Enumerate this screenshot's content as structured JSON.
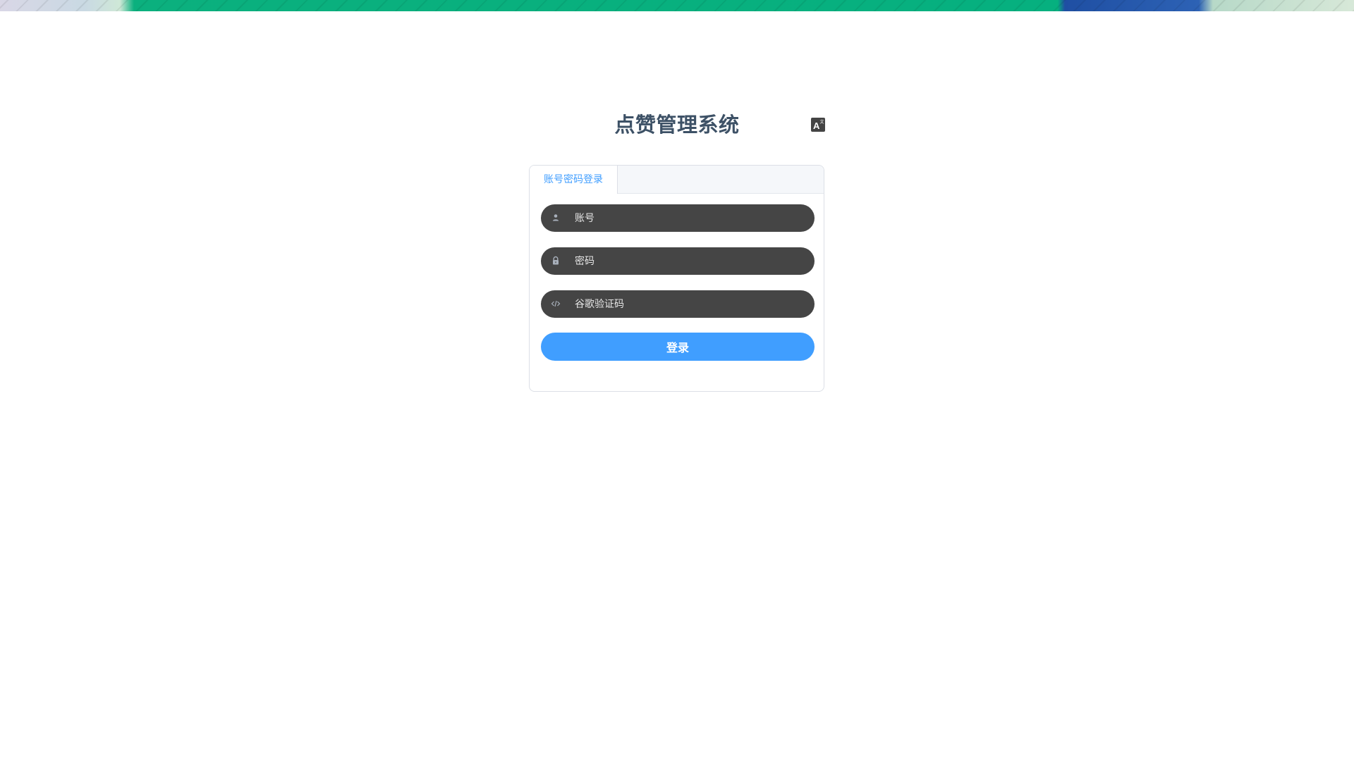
{
  "header": {
    "title": "点赞管理系统",
    "lang_icon": "translate-icon"
  },
  "login": {
    "tabs": [
      {
        "label": "账号密码登录",
        "active": true
      }
    ],
    "account": {
      "placeholder": "账号",
      "value": "",
      "icon": "user-icon"
    },
    "password": {
      "placeholder": "密码",
      "value": "",
      "icon": "lock-icon"
    },
    "google_code": {
      "placeholder": "谷歌验证码",
      "value": "",
      "icon": "code-icon"
    },
    "submit_label": "登录"
  },
  "colors": {
    "primary": "#409eff",
    "title": "#3d5166",
    "input_bg": "#454545",
    "banner_green": "#06b07f",
    "banner_blue": "#2d62b5"
  }
}
